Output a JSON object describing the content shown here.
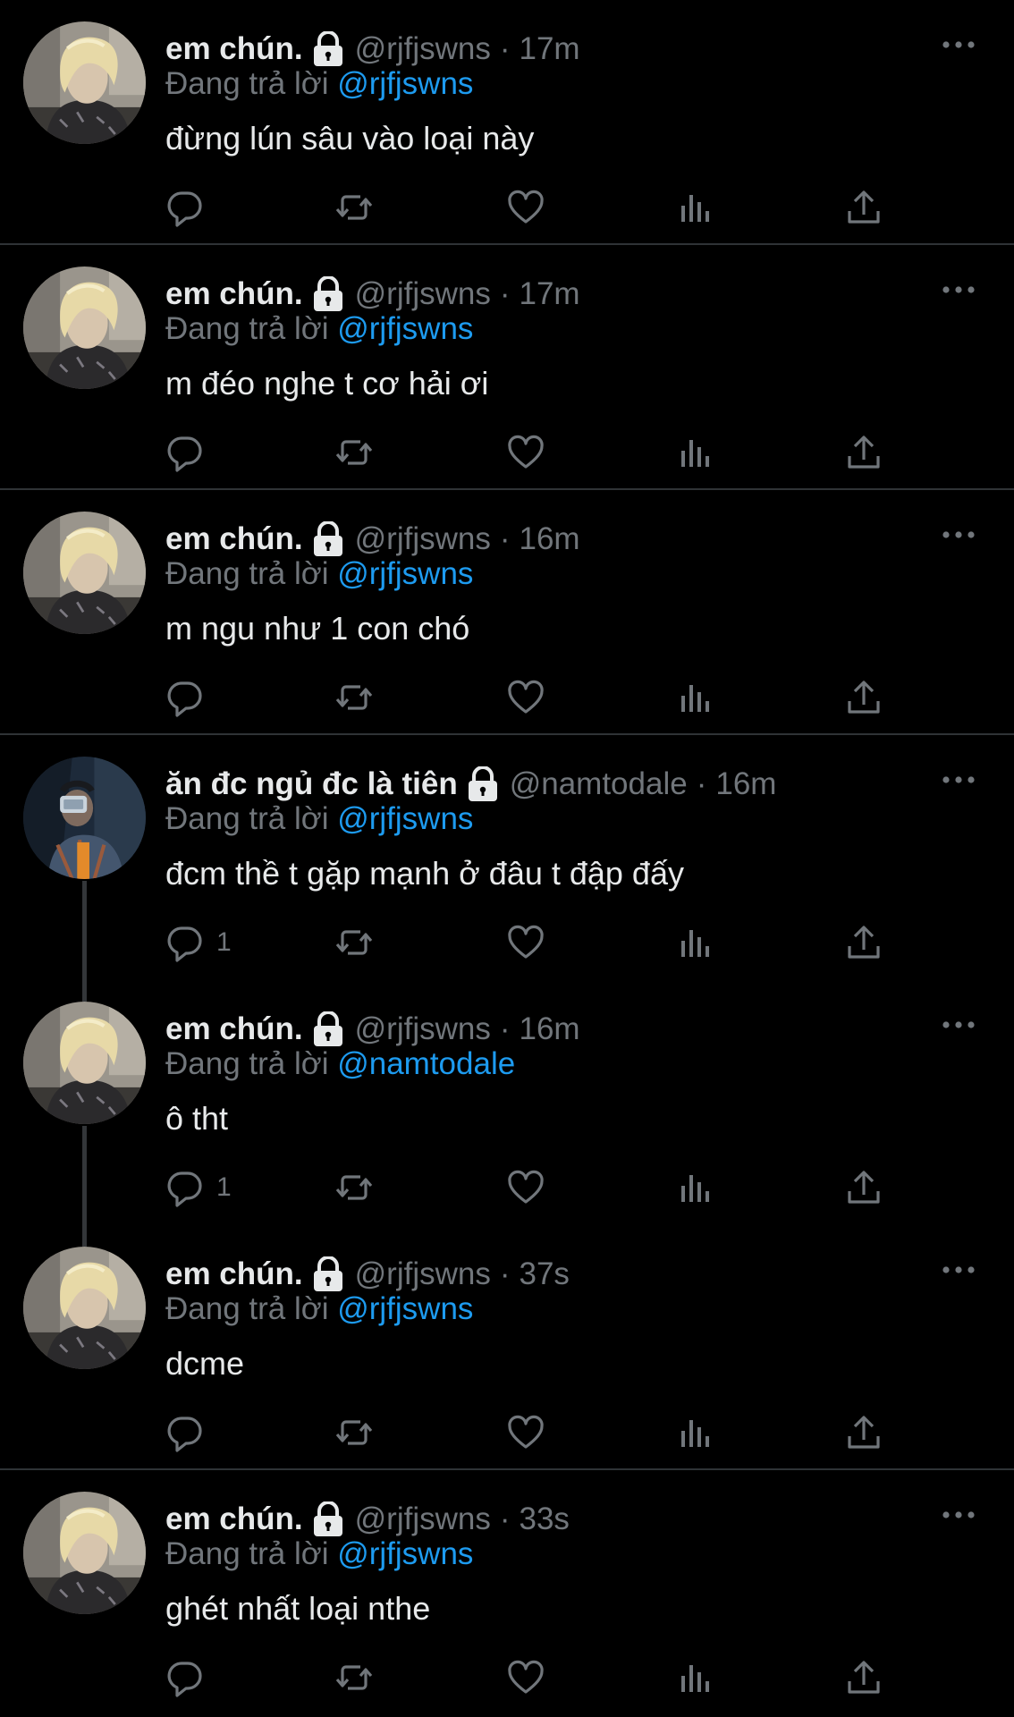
{
  "colors": {
    "background": "#000000",
    "text": "#e7e9ea",
    "secondary": "#71767b",
    "mention": "#1d9bf0",
    "divider": "#2f3336"
  },
  "reply_prefix": "Đang trả lời",
  "tweets": [
    {
      "name": "em chún.",
      "handle": "@rjfjswns",
      "dot": "·",
      "time": "17m",
      "reply_to": "@rjfjswns",
      "text": "đừng lún sâu vào loại này",
      "reply_count": "",
      "avatar": "blond-avatar",
      "icons": [
        "reply-icon",
        "retweet-icon",
        "like-icon",
        "views-icon",
        "share-icon"
      ]
    },
    {
      "name": "em chún.",
      "handle": "@rjfjswns",
      "dot": "·",
      "time": "17m",
      "reply_to": "@rjfjswns",
      "text": "m đéo nghe t cơ hải ơi",
      "reply_count": "",
      "avatar": "blond-avatar"
    },
    {
      "name": "em chún.",
      "handle": "@rjfjswns",
      "dot": "·",
      "time": "16m",
      "reply_to": "@rjfjswns",
      "text": "m ngu như 1 con chó",
      "reply_count": "",
      "avatar": "blond-avatar"
    },
    {
      "name": "ăn đc ngủ đc là tiên",
      "handle": "@namtodale",
      "dot": "·",
      "time": "16m",
      "reply_to": "@rjfjswns",
      "text": "đcm thề t gặp mạnh ở đâu t đập đấy",
      "reply_count": "1",
      "avatar": "mirror-selfie-avatar"
    },
    {
      "name": "em chún.",
      "handle": "@rjfjswns",
      "dot": "·",
      "time": "16m",
      "reply_to": "@namtodale",
      "text": "ô tht",
      "reply_count": "1",
      "avatar": "blond-avatar"
    },
    {
      "name": "em chún.",
      "handle": "@rjfjswns",
      "dot": "·",
      "time": "37s",
      "reply_to": "@rjfjswns",
      "text": "dcme",
      "reply_count": "",
      "avatar": "blond-avatar"
    },
    {
      "name": "em chún.",
      "handle": "@rjfjswns",
      "dot": "·",
      "time": "33s",
      "reply_to": "@rjfjswns",
      "text": "ghét nhất loại nthe",
      "reply_count": "",
      "avatar": "blond-avatar"
    }
  ]
}
